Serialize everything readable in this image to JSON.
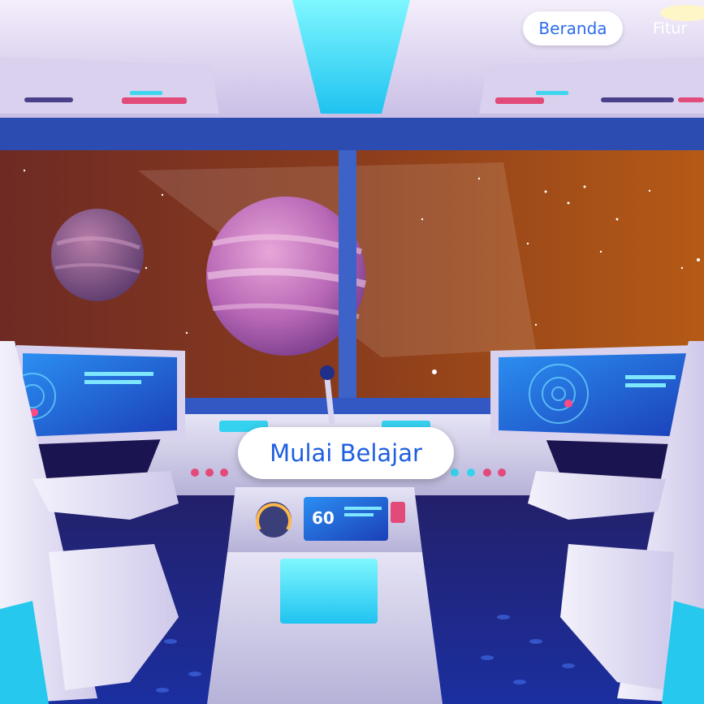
{
  "nav": {
    "home_label": "Beranda",
    "features_label": "Fitur"
  },
  "hero": {
    "cta_label": "Mulai Belajar"
  },
  "console": {
    "display_value": "60"
  }
}
